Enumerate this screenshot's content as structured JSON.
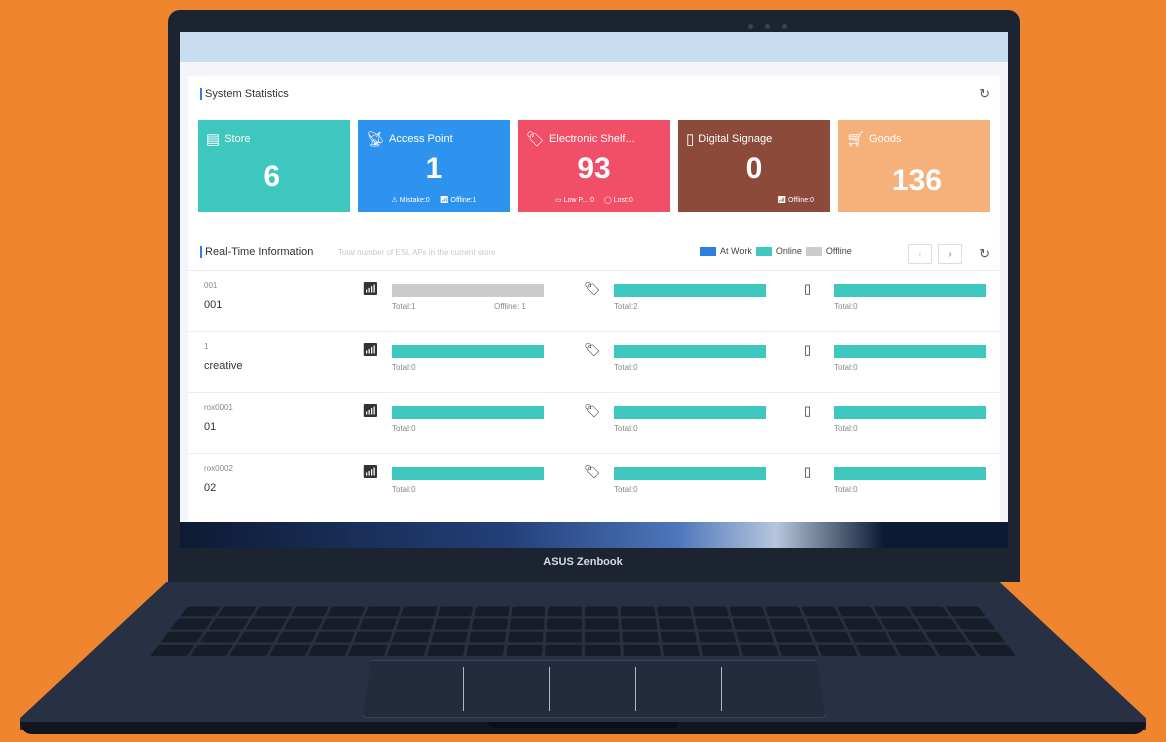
{
  "app": {
    "stats_title": "System Statistics",
    "realtime_title": "Real-Time Information",
    "tooltip": "Total number of ESL APs in the current store",
    "legend": [
      "At Work",
      "Online",
      "Offline"
    ],
    "colors": {
      "accent": "#2f7ee0",
      "online": "#3dc7be",
      "offline": "#cccccc"
    }
  },
  "cards": {
    "store": {
      "label": "Store",
      "value": "6"
    },
    "ap": {
      "label": "Access Point",
      "value": "1",
      "sub1": "Mistake:0",
      "sub2": "Offline:1"
    },
    "esl": {
      "label": "Electronic Shelf...",
      "value": "93",
      "sub1": "Low P... 0",
      "sub2": "Lost:0"
    },
    "signage": {
      "label": "Digital Signage",
      "value": "0",
      "sub1": "Offline:0"
    },
    "goods": {
      "label": "Goods",
      "value": "136"
    }
  },
  "rows": [
    {
      "code": "001",
      "name": "001",
      "ap_total": "Total:1",
      "ap_offline": "Offline: 1",
      "esl_total": "Total:2",
      "ds_total": "Total:0"
    },
    {
      "code": "1",
      "name": "creative",
      "ap_total": "Total:0",
      "ap_offline": "",
      "esl_total": "Total:0",
      "ds_total": "Total:0"
    },
    {
      "code": "rox0001",
      "name": "01",
      "ap_total": "Total:0",
      "ap_offline": "",
      "esl_total": "Total:0",
      "ds_total": "Total:0"
    },
    {
      "code": "rox0002",
      "name": "02",
      "ap_total": "Total:0",
      "ap_offline": "",
      "esl_total": "Total:0",
      "ds_total": "Total:0"
    }
  ],
  "laptop": {
    "brand": "ASUS Zenbook"
  }
}
